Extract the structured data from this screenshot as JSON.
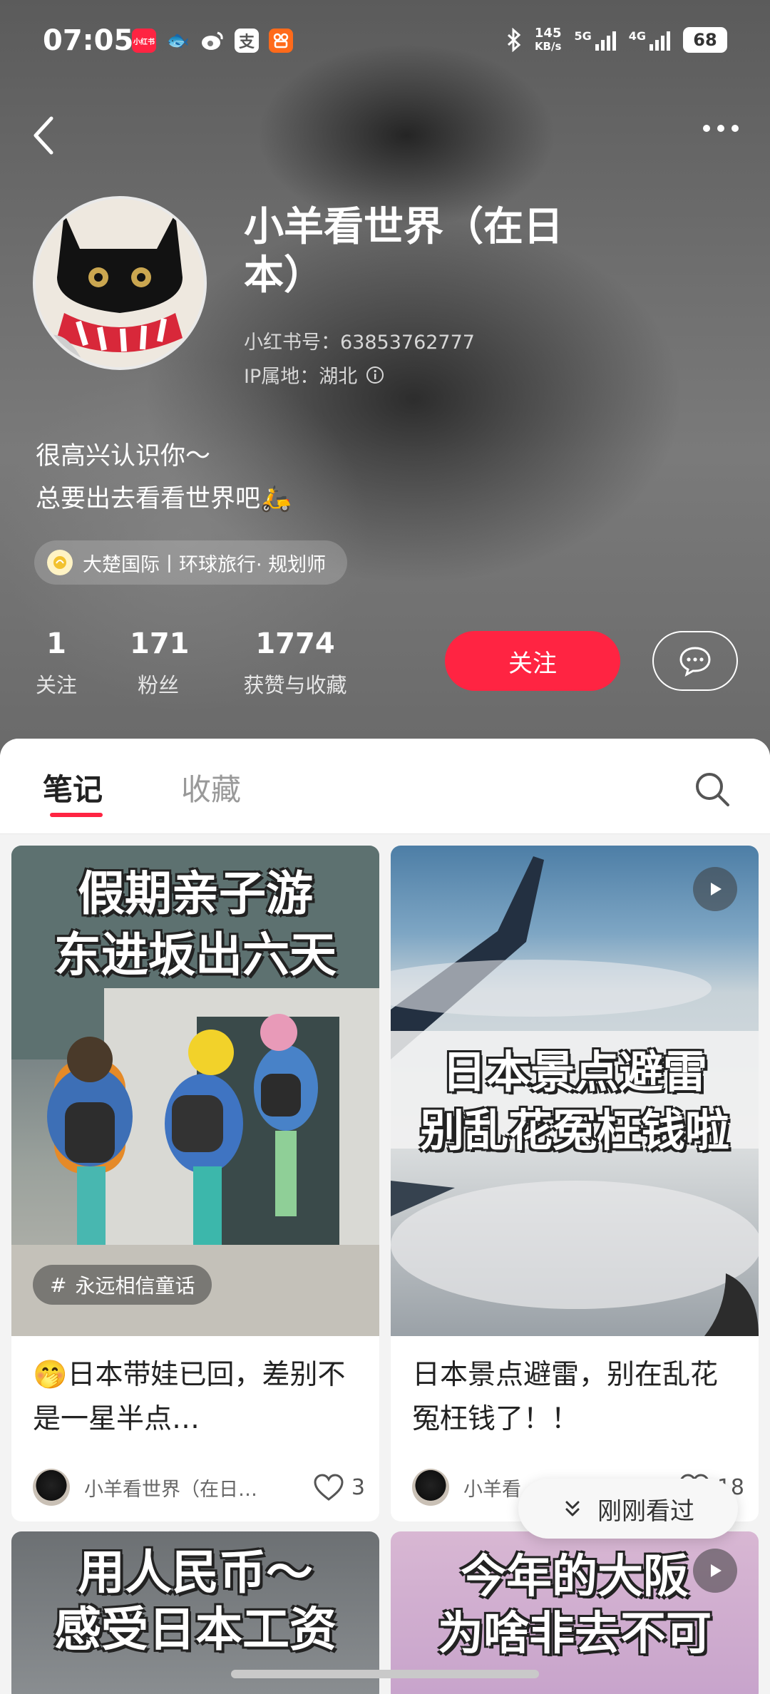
{
  "status_bar": {
    "time": "07:05",
    "net_speed_value": "145",
    "net_speed_unit": "KB/s",
    "sig1_label": "5G",
    "sig2_label": "4G",
    "battery": "68",
    "app_icons": [
      "xiaohongshu-icon",
      "fish-icon",
      "weibo-icon",
      "alipay-icon",
      "kuaishou-icon"
    ]
  },
  "profile": {
    "name": "小羊看世界（在日本）",
    "red_id": "小红书号：63853762777",
    "ip_location": "IP属地：湖北",
    "bio_line1": "很高兴认识你～",
    "bio_line2": "总要出去看看世界吧🛵",
    "tag": "大楚国际丨环球旅行· 规划师",
    "stats": [
      {
        "num": "1",
        "label": "关注"
      },
      {
        "num": "171",
        "label": "粉丝"
      },
      {
        "num": "1774",
        "label": "获赞与收藏"
      }
    ],
    "follow_label": "关注"
  },
  "tabs": {
    "notes": "笔记",
    "collections": "收藏"
  },
  "notes": [
    {
      "cover_line1": "假期亲子游",
      "cover_line2": "东进坂出六天",
      "hashtag": "永远相信童话",
      "title": "🤭日本带娃已回，差别不是一星半点…",
      "author": "小羊看世界（在日…",
      "likes": "3"
    },
    {
      "cover_line1": "日本景点避雷",
      "cover_line2": "别乱花冤枉钱啦",
      "title": "日本景点避雷，别在乱花冤枉钱了！！",
      "author": "小羊看",
      "likes": "18"
    },
    {
      "cover_line1": "用人民币～",
      "cover_line2": "感受日本工资"
    },
    {
      "cover_line1": "今年的大阪",
      "cover_line2": "为啥非去不可"
    }
  ],
  "recent_label": "刚刚看过",
  "colors": {
    "brand_red": "#ff2442"
  }
}
